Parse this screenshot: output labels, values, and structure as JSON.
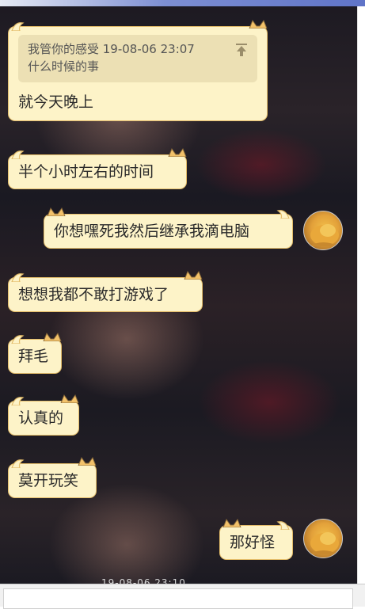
{
  "quote": {
    "header": "我管你的感受 19-08-06 23:07",
    "text": "什么时候的事"
  },
  "messages": [
    {
      "text": "就今天晚上",
      "side": "left"
    },
    {
      "text": "半个小时左右的时间",
      "side": "left"
    },
    {
      "text": "你想嘿死我然后继承我滴电脑",
      "side": "right"
    },
    {
      "text": "想想我都不敢打游戏了",
      "side": "left"
    },
    {
      "text": "拜毛",
      "side": "left"
    },
    {
      "text": "认真的",
      "side": "left"
    },
    {
      "text": "莫开玩笑",
      "side": "left"
    },
    {
      "text": "那好怪",
      "side": "right"
    }
  ],
  "timestamp": "19-08-06 23:10",
  "colors": {
    "bubble_bg": "#fdf3c8",
    "bubble_border": "#e4bd6a",
    "quote_bg": "#ece0b4",
    "title_bar": "#5f74c8"
  }
}
